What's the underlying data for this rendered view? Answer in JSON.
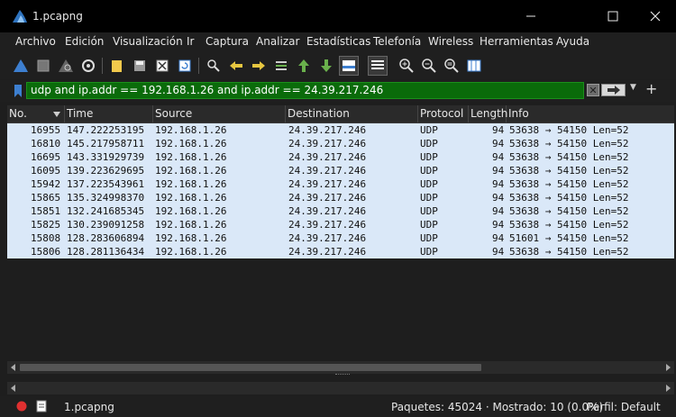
{
  "window": {
    "title": "1.pcapng",
    "minimize_icon": "minimize-icon",
    "maximize_icon": "maximize-icon",
    "close_icon": "close-icon"
  },
  "menu": [
    {
      "label": "Archivo"
    },
    {
      "label": "Edición"
    },
    {
      "label": "Visualización"
    },
    {
      "label": "Ir"
    },
    {
      "label": "Captura"
    },
    {
      "label": "Analizar"
    },
    {
      "label": "Estadísticas"
    },
    {
      "label": "Telefonía"
    },
    {
      "label": "Wireless"
    },
    {
      "label": "Herramientas"
    },
    {
      "label": "Ayuda"
    }
  ],
  "filter": {
    "value": "udp and ip.addr == 192.168.1.26 and ip.addr == 24.39.217.246",
    "bg_color": "#0a6b0a"
  },
  "columns": [
    "No.",
    "Time",
    "Source",
    "Destination",
    "Protocol",
    "Length",
    "Info"
  ],
  "rows": [
    {
      "no": "16955",
      "time": "147.222253195",
      "src": "192.168.1.26",
      "dst": "24.39.217.246",
      "proto": "UDP",
      "len": "94",
      "info": "53638 → 54150 Len=52"
    },
    {
      "no": "16810",
      "time": "145.217958711",
      "src": "192.168.1.26",
      "dst": "24.39.217.246",
      "proto": "UDP",
      "len": "94",
      "info": "53638 → 54150 Len=52"
    },
    {
      "no": "16695",
      "time": "143.331929739",
      "src": "192.168.1.26",
      "dst": "24.39.217.246",
      "proto": "UDP",
      "len": "94",
      "info": "53638 → 54150 Len=52"
    },
    {
      "no": "16095",
      "time": "139.223629695",
      "src": "192.168.1.26",
      "dst": "24.39.217.246",
      "proto": "UDP",
      "len": "94",
      "info": "53638 → 54150 Len=52"
    },
    {
      "no": "15942",
      "time": "137.223543961",
      "src": "192.168.1.26",
      "dst": "24.39.217.246",
      "proto": "UDP",
      "len": "94",
      "info": "53638 → 54150 Len=52"
    },
    {
      "no": "15865",
      "time": "135.324998370",
      "src": "192.168.1.26",
      "dst": "24.39.217.246",
      "proto": "UDP",
      "len": "94",
      "info": "53638 → 54150 Len=52"
    },
    {
      "no": "15851",
      "time": "132.241685345",
      "src": "192.168.1.26",
      "dst": "24.39.217.246",
      "proto": "UDP",
      "len": "94",
      "info": "53638 → 54150 Len=52"
    },
    {
      "no": "15825",
      "time": "130.239091258",
      "src": "192.168.1.26",
      "dst": "24.39.217.246",
      "proto": "UDP",
      "len": "94",
      "info": "53638 → 54150 Len=52"
    },
    {
      "no": "15808",
      "time": "128.283606894",
      "src": "192.168.1.26",
      "dst": "24.39.217.246",
      "proto": "UDP",
      "len": "94",
      "info": "51601 → 54150 Len=52"
    },
    {
      "no": "15806",
      "time": "128.281136434",
      "src": "192.168.1.26",
      "dst": "24.39.217.246",
      "proto": "UDP",
      "len": "94",
      "info": "53638 → 54150 Len=52"
    }
  ],
  "row_color": "#dae8f8",
  "status": {
    "file": "1.pcapng",
    "packets": "Paquetes: 45024 · Mostrado: 10 (0.0%)",
    "profile": "Perfil: Default"
  }
}
